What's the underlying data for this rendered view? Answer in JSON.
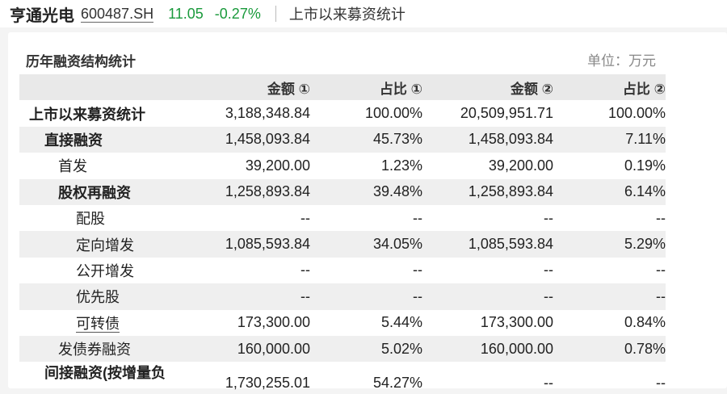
{
  "stock": {
    "name": "亨通光电",
    "code": "600487.SH",
    "price": "11.05",
    "change": "-0.27%"
  },
  "page_title": "上市以来募资统计",
  "colors": {
    "up_down_green": "#1a9a3c",
    "row_stripe": "#efefef",
    "header_bg": "#e9e9e9"
  },
  "section": {
    "title": "历年融资结构统计",
    "unit": "单位：万元"
  },
  "table": {
    "columns": [
      "金额 ①",
      "占比 ①",
      "金额 ②",
      "占比 ②"
    ],
    "rows": [
      {
        "label": "上市以来募资统计",
        "amount1": "3,188,348.84",
        "ratio1": "100.00%",
        "amount2": "20,509,951.71",
        "ratio2": "100.00%"
      },
      {
        "label": "直接融资",
        "amount1": "1,458,093.84",
        "ratio1": "45.73%",
        "amount2": "1,458,093.84",
        "ratio2": "7.11%"
      },
      {
        "label": "首发",
        "amount1": "39,200.00",
        "ratio1": "1.23%",
        "amount2": "39,200.00",
        "ratio2": "0.19%"
      },
      {
        "label": "股权再融资",
        "amount1": "1,258,893.84",
        "ratio1": "39.48%",
        "amount2": "1,258,893.84",
        "ratio2": "6.14%"
      },
      {
        "label": "配股",
        "amount1": "--",
        "ratio1": "--",
        "amount2": "--",
        "ratio2": "--"
      },
      {
        "label": "定向增发",
        "amount1": "1,085,593.84",
        "ratio1": "34.05%",
        "amount2": "1,085,593.84",
        "ratio2": "5.29%"
      },
      {
        "label": "公开增发",
        "amount1": "--",
        "ratio1": "--",
        "amount2": "--",
        "ratio2": "--"
      },
      {
        "label": "优先股",
        "amount1": "--",
        "ratio1": "--",
        "amount2": "--",
        "ratio2": "--"
      },
      {
        "label": "可转债",
        "amount1": "173,300.00",
        "ratio1": "5.44%",
        "amount2": "173,300.00",
        "ratio2": "0.84%"
      },
      {
        "label": "发债券融资",
        "amount1": "160,000.00",
        "ratio1": "5.02%",
        "amount2": "160,000.00",
        "ratio2": "0.78%"
      },
      {
        "label": "间接融资(按增量负",
        "amount1": "1,730,255.01",
        "ratio1": "54.27%",
        "amount2": "--",
        "ratio2": "--"
      }
    ]
  }
}
